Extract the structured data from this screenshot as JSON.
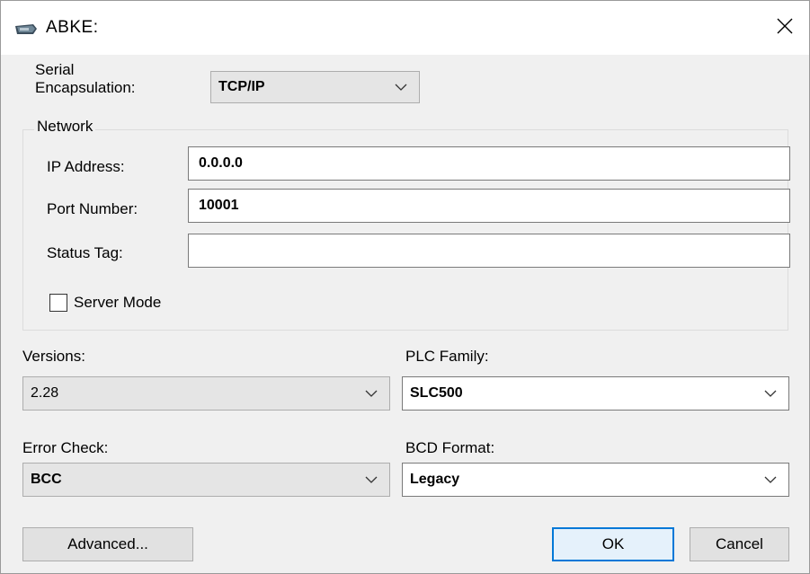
{
  "window": {
    "title": "ABKE:",
    "icon": "device-icon",
    "close_icon": "close-icon"
  },
  "serial": {
    "label": "Serial\nEncapsulation:",
    "label_line1": "Serial",
    "label_line2": "Encapsulation:",
    "value": "TCP/IP"
  },
  "network": {
    "group_label": "Network",
    "ip_label": "IP  Address:",
    "ip_value": "0.0.0.0",
    "port_label": "Port Number:",
    "port_value": "10001",
    "status_tag_label": "Status Tag:",
    "status_tag_value": "",
    "server_mode_label": "Server Mode",
    "server_mode_checked": false
  },
  "versions": {
    "label": "Versions:",
    "value": "2.28"
  },
  "plc_family": {
    "label": "PLC Family:",
    "value": "SLC500"
  },
  "error_check": {
    "label": "Error Check:",
    "value": "BCC"
  },
  "bcd_format": {
    "label": "BCD Format:",
    "value": "Legacy"
  },
  "buttons": {
    "advanced": "Advanced...",
    "ok": "OK",
    "cancel": "Cancel"
  },
  "colors": {
    "window_bg": "#f0f0f0",
    "titlebar_bg": "#ffffff",
    "default_button_border": "#0078d7"
  }
}
